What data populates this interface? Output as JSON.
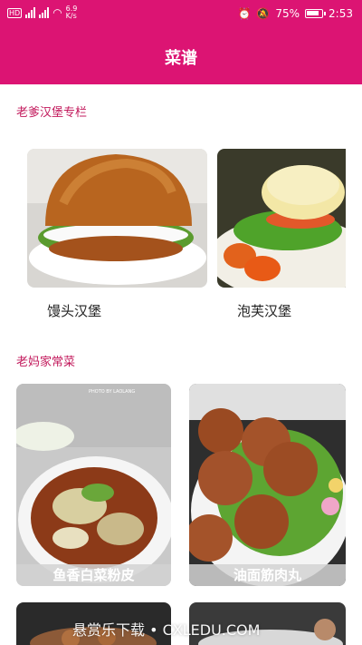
{
  "status": {
    "left_small_top": "6.9",
    "left_small_bottom": "K/s",
    "battery": "75%",
    "time": "2:53"
  },
  "header": {
    "title": "菜谱"
  },
  "sections": [
    {
      "title": "老爹汉堡专栏",
      "items": [
        {
          "label": "馒头汉堡"
        },
        {
          "label": "泡芙汉堡"
        }
      ]
    },
    {
      "title": "老妈家常菜",
      "items": [
        {
          "label": "鱼香白菜粉皮"
        },
        {
          "label": "油面筋肉丸"
        }
      ]
    }
  ],
  "watermark": "悬赏乐下载 • CXLEDU.COM",
  "photo_watermark": "PHOTO BY LAOLANG"
}
